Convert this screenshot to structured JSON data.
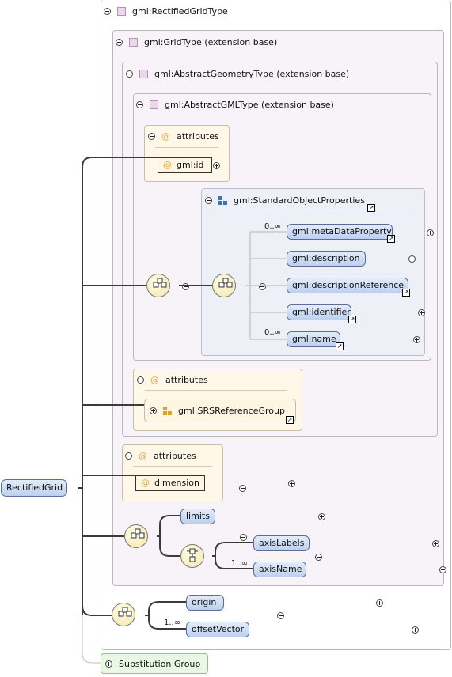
{
  "root": {
    "label": "RectifiedGrid"
  },
  "rectified_grid_type": {
    "title": "gml:RectifiedGridType"
  },
  "grid_type": {
    "title": "gml:GridType (extension base)"
  },
  "abstract_geometry_type": {
    "title": "gml:AbstractGeometryType (extension base)"
  },
  "abstract_gml_type": {
    "title": "gml:AbstractGMLType (extension base)"
  },
  "attributes_gml_id": {
    "title": "attributes",
    "item": "gml:id"
  },
  "standard_object_properties": {
    "title": "gml:StandardObjectProperties",
    "elements": [
      {
        "label": "gml:metaDataProperty",
        "occurrence": "0..∞"
      },
      {
        "label": "gml:description",
        "occurrence": ""
      },
      {
        "label": "gml:descriptionReference",
        "occurrence": ""
      },
      {
        "label": "gml:identifier",
        "occurrence": ""
      },
      {
        "label": "gml:name",
        "occurrence": "0..∞"
      }
    ]
  },
  "attributes_srs": {
    "title": "attributes",
    "item": "gml:SRSReferenceGroup"
  },
  "attributes_dimension": {
    "title": "attributes",
    "item": "dimension"
  },
  "grid_elements": {
    "limits": "limits",
    "axis_labels": "axisLabels",
    "axis_name": "axisName",
    "axis_name_occurrence": "1..∞"
  },
  "rectified_elements": {
    "origin": "origin",
    "offset_vector": "offsetVector",
    "offset_vector_occurrence": "1..∞"
  },
  "substitution_group": {
    "label": "Substitution Group"
  },
  "colors": {
    "frame_fill": "#f8f3f8",
    "attr_fill": "#fff5e3",
    "node_fill": "#cddcf4",
    "subst_fill": "#eaf7e2"
  },
  "icons": {
    "type": "purple-square-icon",
    "group": "blue-squares-icon",
    "attr_group": "orange-squares-icon",
    "sequence": "sequence-icon",
    "choice": "choice-icon",
    "reference": "reference-arrow-icon"
  }
}
